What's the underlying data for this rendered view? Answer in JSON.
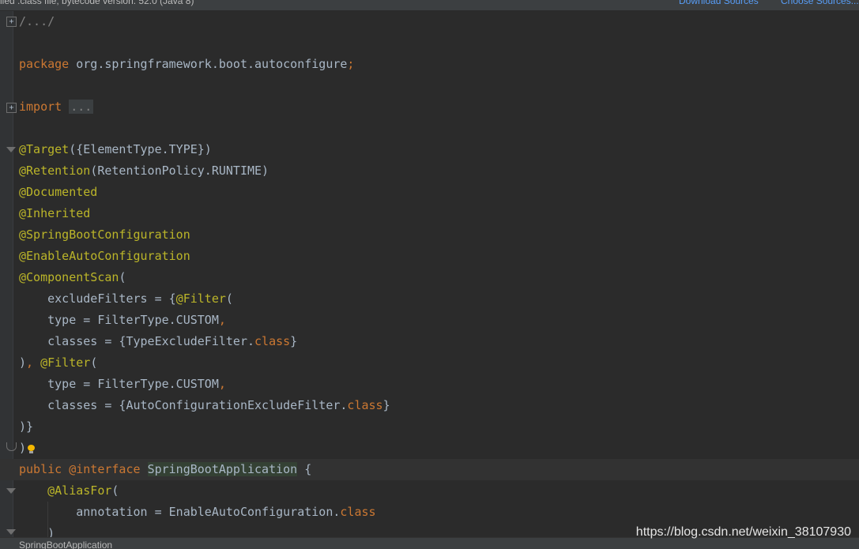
{
  "banner": {
    "text": "iled .class file, bytecode version: 52.0 (Java 8)",
    "download_sources": "Download Sources",
    "choose_sources": "Choose Sources..."
  },
  "editor": {
    "fold_plus_glyph": "+",
    "lines": [
      [
        {
          "t": "/.../",
          "c": "cm"
        }
      ],
      [],
      [
        {
          "t": "package",
          "c": "kw"
        },
        {
          "t": " org.springframework.boot.autoconfigure",
          "c": "tx"
        },
        {
          "t": ";",
          "c": "kw"
        }
      ],
      [],
      [
        {
          "t": "import",
          "c": "kw"
        },
        {
          "t": " ",
          "c": "tx"
        },
        {
          "t": "...",
          "c": "fold-box"
        }
      ],
      [],
      [
        {
          "t": "@Target",
          "c": "an"
        },
        {
          "t": "({ElementType.TYPE})",
          "c": "tx"
        }
      ],
      [
        {
          "t": "@Retention",
          "c": "an"
        },
        {
          "t": "(RetentionPolicy.RUNTIME)",
          "c": "tx"
        }
      ],
      [
        {
          "t": "@Documented",
          "c": "an"
        }
      ],
      [
        {
          "t": "@Inherited",
          "c": "an"
        }
      ],
      [
        {
          "t": "@SpringBootConfiguration",
          "c": "an"
        }
      ],
      [
        {
          "t": "@EnableAutoConfiguration",
          "c": "an"
        }
      ],
      [
        {
          "t": "@ComponentScan",
          "c": "an"
        },
        {
          "t": "(",
          "c": "tx"
        }
      ],
      [
        {
          "t": "    excludeFilters = {",
          "c": "tx"
        },
        {
          "t": "@Filter",
          "c": "an"
        },
        {
          "t": "(",
          "c": "tx"
        }
      ],
      [
        {
          "t": "    type = FilterType.CUSTOM",
          "c": "tx"
        },
        {
          "t": ",",
          "c": "kw"
        }
      ],
      [
        {
          "t": "    classes = {TypeExcludeFilter.",
          "c": "tx"
        },
        {
          "t": "class",
          "c": "kw"
        },
        {
          "t": "}",
          "c": "tx"
        }
      ],
      [
        {
          "t": ")",
          "c": "tx"
        },
        {
          "t": ",",
          "c": "kw"
        },
        {
          "t": " ",
          "c": "tx"
        },
        {
          "t": "@Filter",
          "c": "an"
        },
        {
          "t": "(",
          "c": "tx"
        }
      ],
      [
        {
          "t": "    type = FilterType.CUSTOM",
          "c": "tx"
        },
        {
          "t": ",",
          "c": "kw"
        }
      ],
      [
        {
          "t": "    classes = {AutoConfigurationExcludeFilter.",
          "c": "tx"
        },
        {
          "t": "class",
          "c": "kw"
        },
        {
          "t": "}",
          "c": "tx"
        }
      ],
      [
        {
          "t": ")}",
          "c": "tx"
        }
      ],
      [
        {
          "t": ")",
          "c": "tx"
        }
      ],
      [
        {
          "t": "public",
          "c": "kw"
        },
        {
          "t": " ",
          "c": "tx"
        },
        {
          "t": "@interface",
          "c": "kw"
        },
        {
          "t": " ",
          "c": "tx"
        },
        {
          "t": "SpringBootApplication",
          "c": "hl"
        },
        {
          "t": " {",
          "c": "tx"
        }
      ],
      [
        {
          "t": "    ",
          "c": "tx"
        },
        {
          "t": "@AliasFor",
          "c": "an"
        },
        {
          "t": "(",
          "c": "tx"
        }
      ],
      [
        {
          "t": "        annotation = EnableAutoConfiguration.",
          "c": "tx"
        },
        {
          "t": "class",
          "c": "kw"
        }
      ],
      [
        {
          "t": "    )",
          "c": "tx"
        }
      ]
    ]
  },
  "status": {
    "breadcrumb": "SpringBootApplication"
  },
  "watermark": "https://blog.csdn.net/weixin_38107930"
}
